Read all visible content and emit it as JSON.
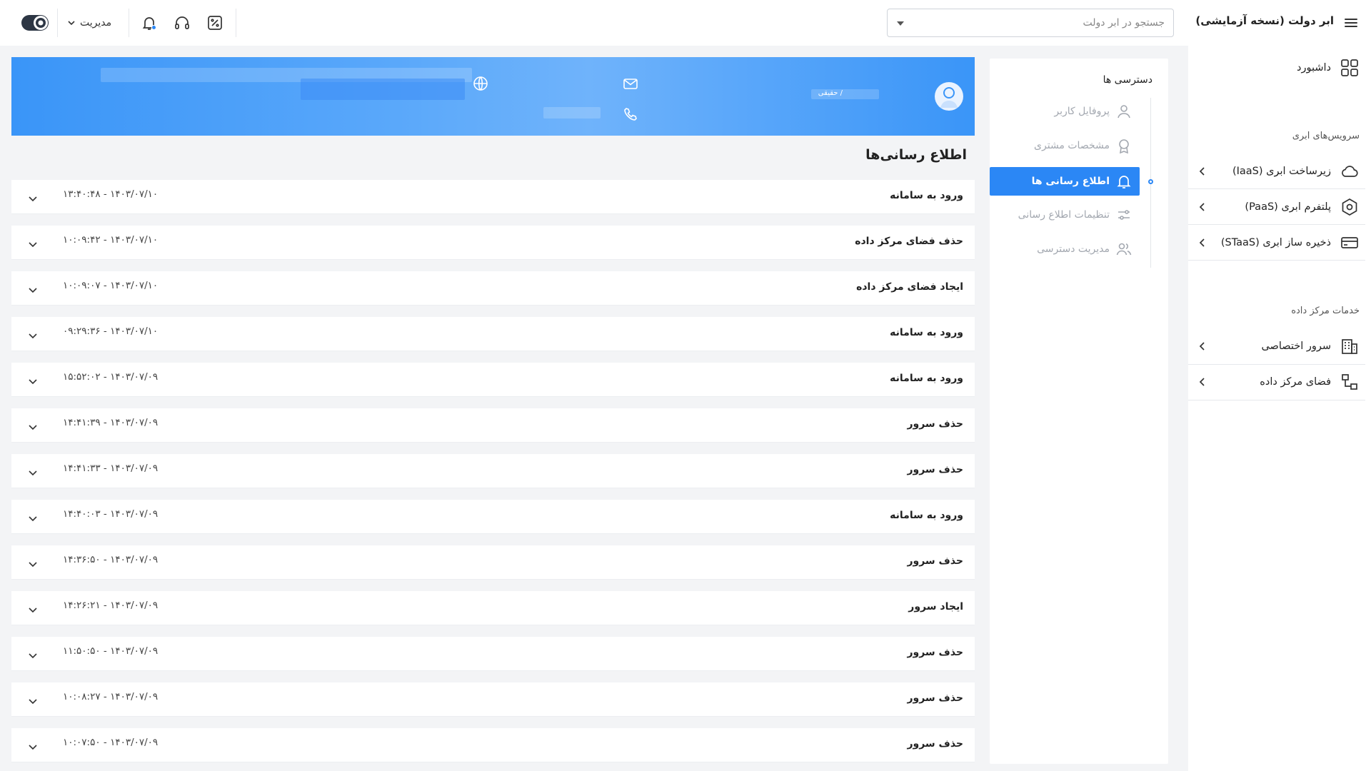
{
  "app": {
    "title": "ابر دولت (نسخه آزمایشی)"
  },
  "sidebar": {
    "dashboard": "داشبورد",
    "cloud_section": "سرویس‌های ابری",
    "cloud_items": [
      {
        "label": "زیرساخت ابری (IaaS)",
        "icon": "cloud-icon"
      },
      {
        "label": "پلتفرم ابری (PaaS)",
        "icon": "hexagon-settings-icon"
      },
      {
        "label": "ذخیره ساز ابری (STaaS)",
        "icon": "storage-card-icon"
      }
    ],
    "dc_section": "خدمات مرکز داده",
    "dc_items": [
      {
        "label": "سرور اختصاصی",
        "icon": "building-icon"
      },
      {
        "label": "فضای مرکز داده",
        "icon": "network-nodes-icon"
      }
    ]
  },
  "topbar": {
    "search_placeholder": "جستجو در ابر دولت",
    "admin_label": "مدیریت"
  },
  "settings_menu": {
    "title": "دسترسی ها",
    "items": [
      {
        "label": "پروفایل کاربر",
        "icon": "user-icon",
        "active": false
      },
      {
        "label": "مشخصات مشتری",
        "icon": "badge-icon",
        "active": false
      },
      {
        "label": "اطلاع رسانی ها",
        "icon": "bell-icon",
        "active": true
      },
      {
        "label": "تنظیمات اطلاع رسانی",
        "icon": "sliders-icon",
        "active": false
      },
      {
        "label": "مدیریت دسترسی",
        "icon": "users-icon",
        "active": false
      }
    ]
  },
  "profile": {
    "user_type": "/ حقیقی"
  },
  "notifications": {
    "title": "اطلاع رسانی‌ها",
    "items": [
      {
        "title": "ورود به سامانه",
        "time": "۱۴۰۳/۰۷/۱۰ - ۱۳:۴۰:۴۸"
      },
      {
        "title": "حذف فضای مرکز داده",
        "time": "۱۴۰۳/۰۷/۱۰ - ۱۰:۰۹:۴۲"
      },
      {
        "title": "ایجاد فضای مرکز داده",
        "time": "۱۴۰۳/۰۷/۱۰ - ۱۰:۰۹:۰۷"
      },
      {
        "title": "ورود به سامانه",
        "time": "۱۴۰۳/۰۷/۱۰ - ۰۹:۲۹:۳۶"
      },
      {
        "title": "ورود به سامانه",
        "time": "۱۴۰۳/۰۷/۰۹ - ۱۵:۵۲:۰۲"
      },
      {
        "title": "حذف سرور",
        "time": "۱۴۰۳/۰۷/۰۹ - ۱۴:۴۱:۳۹"
      },
      {
        "title": "حذف سرور",
        "time": "۱۴۰۳/۰۷/۰۹ - ۱۴:۴۱:۳۳"
      },
      {
        "title": "ورود به سامانه",
        "time": "۱۴۰۳/۰۷/۰۹ - ۱۴:۴۰:۰۳"
      },
      {
        "title": "حذف سرور",
        "time": "۱۴۰۳/۰۷/۰۹ - ۱۴:۳۶:۵۰"
      },
      {
        "title": "ایجاد سرور",
        "time": "۱۴۰۳/۰۷/۰۹ - ۱۴:۲۶:۲۱"
      },
      {
        "title": "حذف سرور",
        "time": "۱۴۰۳/۰۷/۰۹ - ۱۱:۵۰:۵۰"
      },
      {
        "title": "حذف سرور",
        "time": "۱۴۰۳/۰۷/۰۹ - ۱۰:۰۸:۲۷"
      },
      {
        "title": "حذف سرور",
        "time": "۱۴۰۳/۰۷/۰۹ - ۱۰:۰۷:۵۰"
      }
    ]
  },
  "colors": {
    "accent": "#2b87f5",
    "banner": "#3a95f8",
    "muted": "#a3a8b0"
  }
}
